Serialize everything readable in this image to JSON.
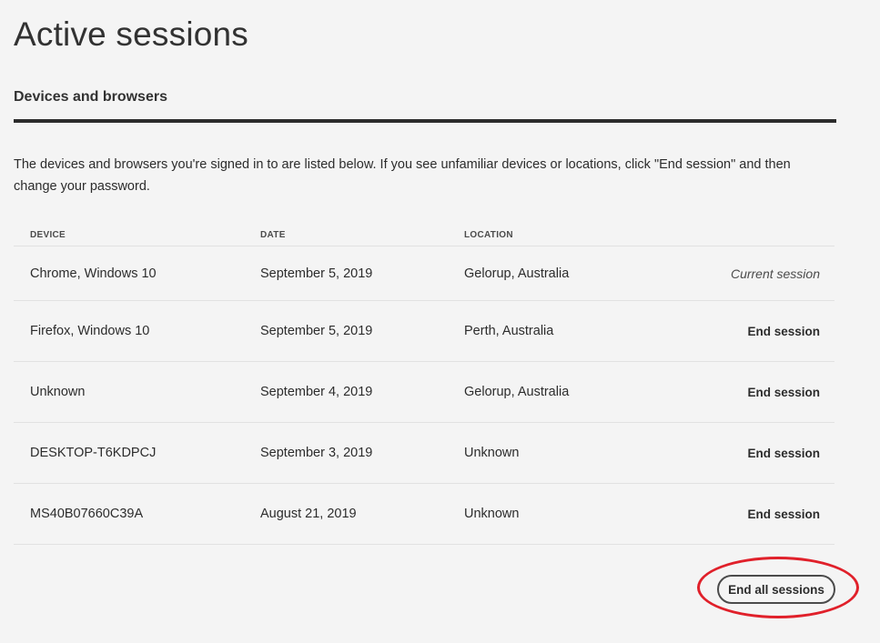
{
  "page": {
    "title": "Active sessions",
    "section_heading": "Devices and browsers",
    "intro": "The devices and browsers you're signed in to are listed below. If you see unfamiliar devices or locations, click \"End session\" and then change your password."
  },
  "table": {
    "headers": {
      "device": "DEVICE",
      "date": "DATE",
      "location": "LOCATION"
    },
    "rows": [
      {
        "device": "Chrome, Windows 10",
        "date": "September 5, 2019",
        "location": "Gelorup, Australia",
        "action": "Current session"
      },
      {
        "device": "Firefox, Windows 10",
        "date": "September 5, 2019",
        "location": "Perth, Australia",
        "action": "End session"
      },
      {
        "device": "Unknown",
        "date": "September 4, 2019",
        "location": "Gelorup, Australia",
        "action": "End session"
      },
      {
        "device": "DESKTOP-T6KDPCJ",
        "date": "September 3, 2019",
        "location": "Unknown",
        "action": "End session"
      },
      {
        "device": "MS40B07660C39A",
        "date": "August 21, 2019",
        "location": "Unknown",
        "action": "End session"
      }
    ]
  },
  "actions": {
    "end_all_label": "End all sessions"
  },
  "colors": {
    "background": "#f4f4f4",
    "text": "#2c2c2c",
    "annotation_ring": "#e0202a"
  }
}
